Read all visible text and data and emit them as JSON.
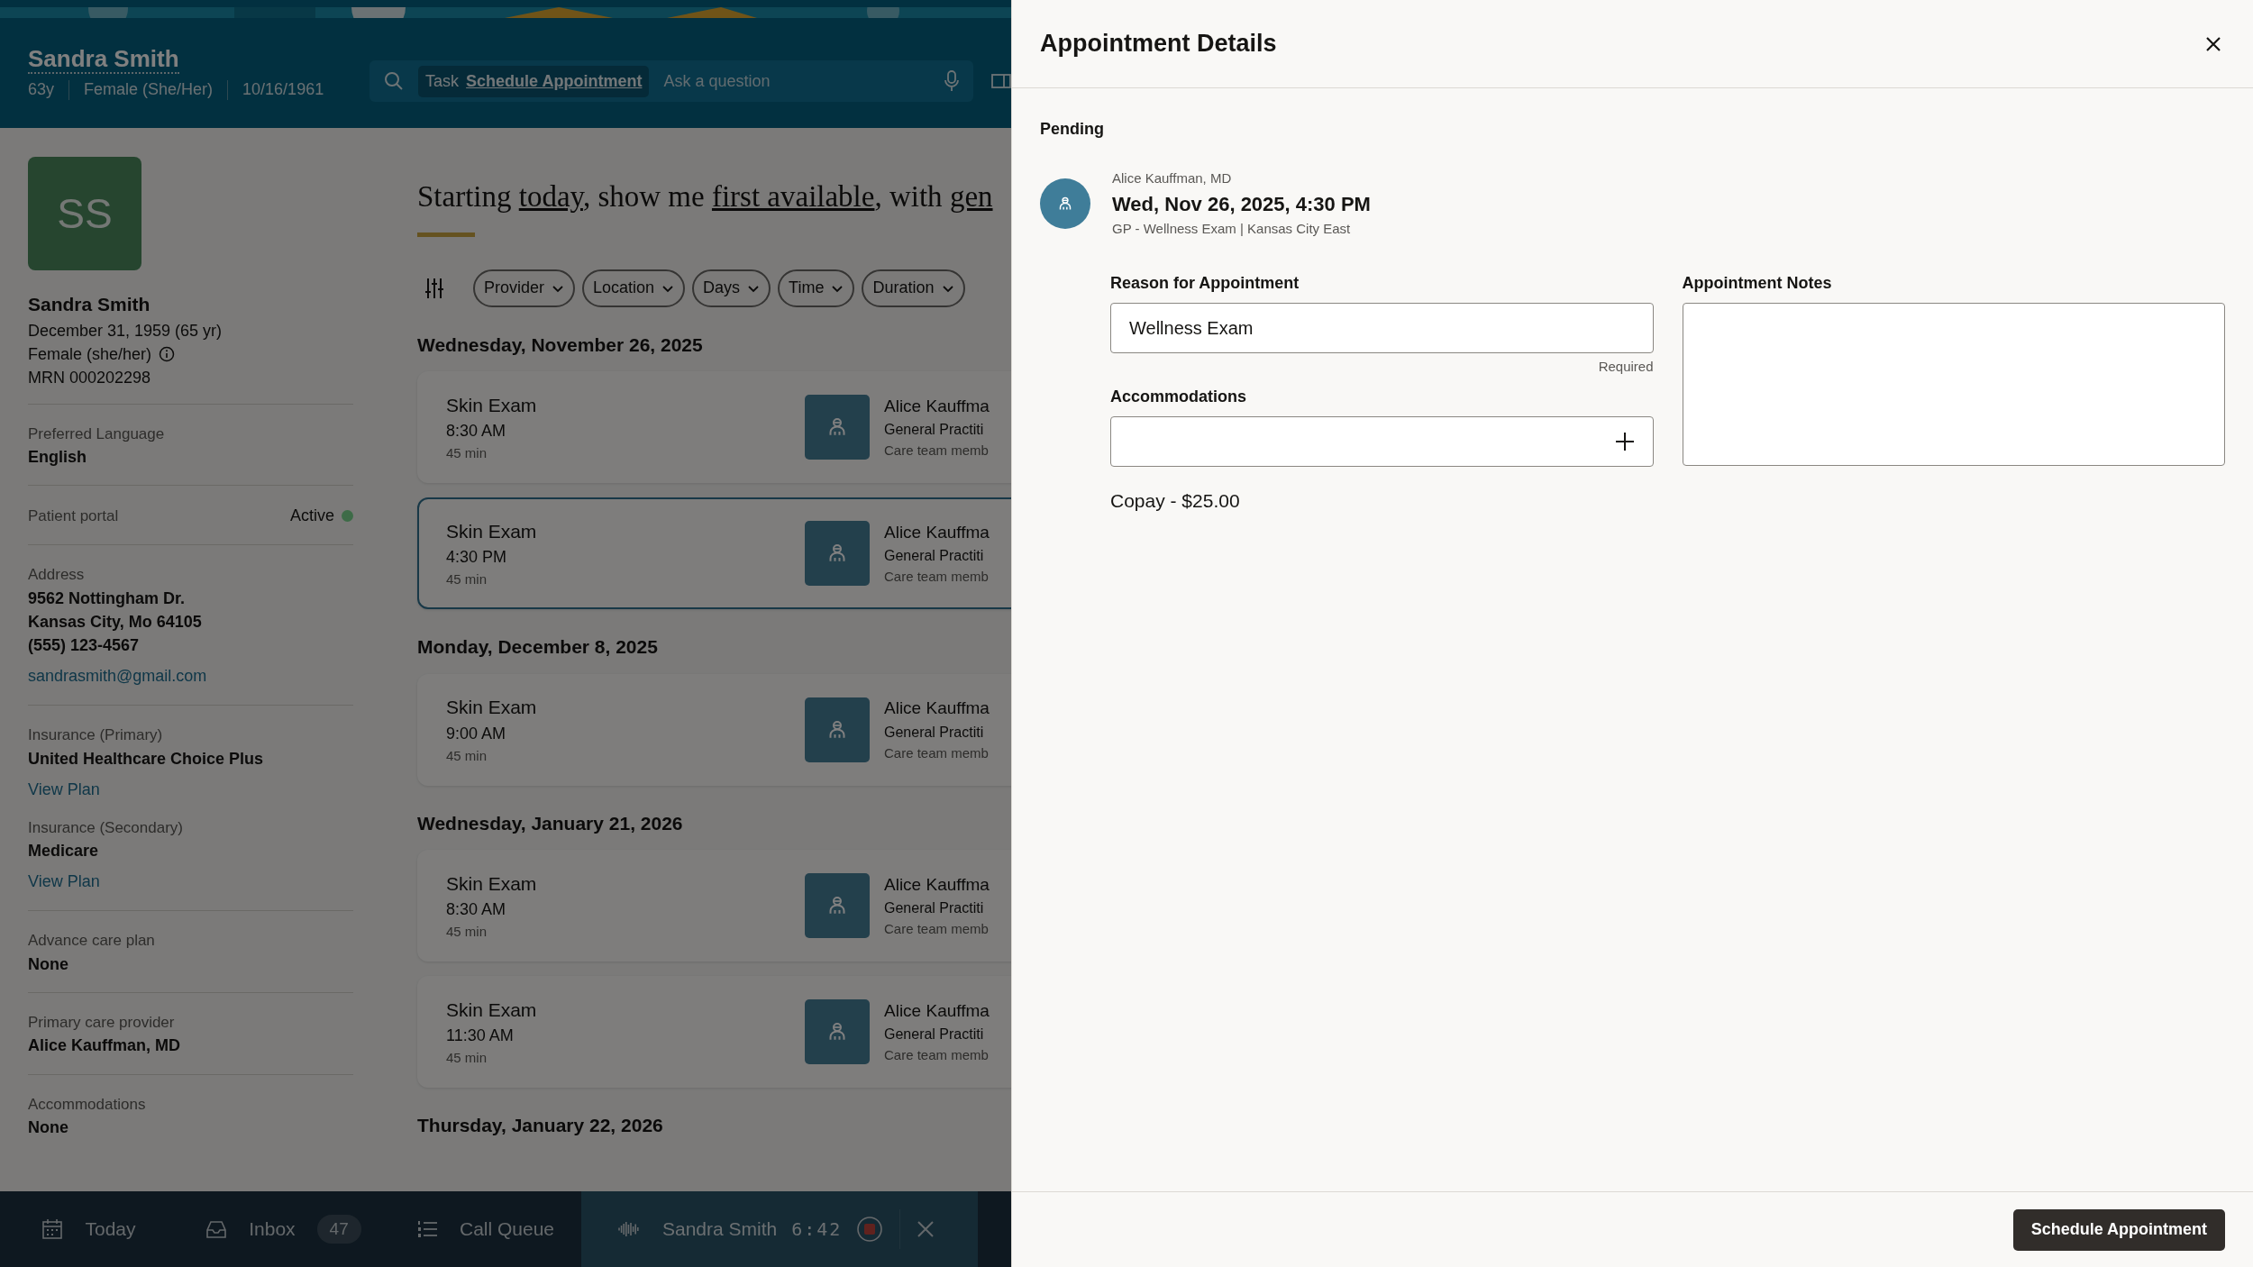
{
  "header": {
    "patient_name": "Sandra Smith",
    "facts": [
      "63y",
      "Female (She/Her)",
      "10/16/1961"
    ]
  },
  "search": {
    "task_label": "Task",
    "task": "Schedule Appointment",
    "placeholder": "Ask a question"
  },
  "sidebar": {
    "initials": "SS",
    "name": "Sandra Smith",
    "details": [
      "December 31, 1959 (65 yr)",
      "Female (she/her)",
      "MRN 000202298"
    ],
    "groups": [
      {
        "items": [
          {
            "kind": "field",
            "label": "Preferred Language",
            "values": [
              "English"
            ]
          }
        ]
      },
      {
        "items": [
          {
            "kind": "status",
            "label": "Patient portal",
            "value": "Active",
            "color": "#3d6b47"
          }
        ]
      },
      {
        "items": [
          {
            "kind": "field",
            "label": "Address",
            "values": [
              "9562 Nottingham Dr.",
              "Kansas City, Mo 64105",
              "(555) 123-4567"
            ],
            "link": "sandrasmith@gmail.com"
          }
        ]
      },
      {
        "items": [
          {
            "kind": "field",
            "label": "Insurance (Primary)",
            "values": [
              "United Healthcare Choice Plus"
            ],
            "link": "View Plan"
          },
          {
            "kind": "field",
            "label": "Insurance (Secondary)",
            "values": [
              "Medicare"
            ],
            "link": "View Plan"
          }
        ]
      },
      {
        "items": [
          {
            "kind": "field",
            "label": "Advance care plan",
            "values": [
              "None"
            ]
          }
        ]
      },
      {
        "items": [
          {
            "kind": "field",
            "label": "Primary care provider",
            "values": [
              "Alice Kauffman, MD"
            ]
          }
        ]
      },
      {
        "items": [
          {
            "kind": "field",
            "label": "Accommodations",
            "values": [
              "None"
            ]
          }
        ]
      }
    ]
  },
  "prompt": [
    {
      "text": "Starting ",
      "underlined": false
    },
    {
      "text": "today",
      "underlined": true
    },
    {
      "text": ", show me ",
      "underlined": false
    },
    {
      "text": "first available",
      "underlined": true
    },
    {
      "text": ", with ",
      "underlined": false
    },
    {
      "text": "gen",
      "underlined": true
    }
  ],
  "filters": [
    "Provider",
    "Location",
    "Days",
    "Time",
    "Duration"
  ],
  "days": [
    {
      "date": "Wednesday, November 26, 2025",
      "slots": [
        {
          "title": "Skin Exam",
          "time": "8:30 AM",
          "duration": "45 min",
          "provider": "Alice Kauffma",
          "specialty": "General Practiti",
          "role": "Care team memb",
          "selected": false
        },
        {
          "title": "Skin Exam",
          "time": "4:30 PM",
          "duration": "45 min",
          "provider": "Alice Kauffma",
          "specialty": "General Practiti",
          "role": "Care team memb",
          "selected": true
        }
      ]
    },
    {
      "date": "Monday, December 8, 2025",
      "slots": [
        {
          "title": "Skin Exam",
          "time": "9:00 AM",
          "duration": "45 min",
          "provider": "Alice Kauffma",
          "specialty": "General Practiti",
          "role": "Care team memb",
          "selected": false
        }
      ]
    },
    {
      "date": "Wednesday, January 21, 2026",
      "slots": [
        {
          "title": "Skin Exam",
          "time": "8:30 AM",
          "duration": "45 min",
          "provider": "Alice Kauffma",
          "specialty": "General Practiti",
          "role": "Care team memb",
          "selected": false
        },
        {
          "title": "Skin Exam",
          "time": "11:30 AM",
          "duration": "45 min",
          "provider": "Alice Kauffma",
          "specialty": "General Practiti",
          "role": "Care team memb",
          "selected": false
        }
      ]
    },
    {
      "date": "Thursday, January 22, 2026"
    }
  ],
  "bottom_bar": {
    "items": [
      {
        "label": "Today"
      },
      {
        "label": "Inbox",
        "count": "47"
      },
      {
        "label": "Call Queue"
      }
    ],
    "call": {
      "name": "Sandra Smith",
      "timer": "6:42"
    }
  },
  "panel": {
    "title": "Appointment Details",
    "status": "Pending",
    "appointment": {
      "provider": "Alice Kauffman, MD",
      "datetime": "Wed, Nov 26, 2025, 4:30 PM",
      "details": "GP - Wellness Exam | Kansas City East"
    },
    "reason": {
      "label": "Reason for Appointment",
      "value": "Wellness Exam",
      "hint": "Required"
    },
    "accommodations": {
      "label": "Accommodations"
    },
    "notes": {
      "label": "Appointment Notes"
    },
    "copay": "Copay - $25.00",
    "button": "Schedule Appointment"
  }
}
